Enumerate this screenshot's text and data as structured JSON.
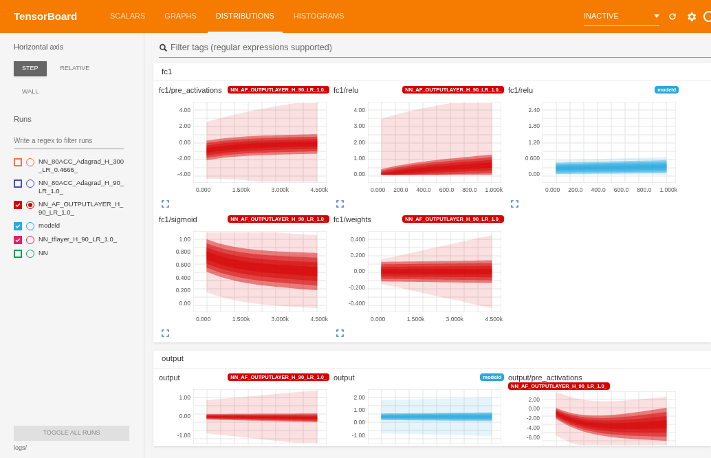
{
  "header": {
    "title": "TensorBoard",
    "tabs": [
      {
        "label": "SCALARS",
        "selected": false
      },
      {
        "label": "GRAPHS",
        "selected": false
      },
      {
        "label": "DISTRIBUTIONS",
        "selected": true
      },
      {
        "label": "HISTOGRAMS",
        "selected": false
      }
    ],
    "status_select": "INACTIVE"
  },
  "sidebar": {
    "horizontal_axis": {
      "label": "Horizontal axis",
      "options": [
        {
          "label": "STEP",
          "selected": true
        },
        {
          "label": "RELATIVE",
          "selected": false
        },
        {
          "label": "WALL",
          "selected": false
        }
      ]
    },
    "runs_label": "Runs",
    "runs_filter": {
      "placeholder": "Write a regex to filter runs"
    },
    "runs": [
      {
        "name": "NN_80ACC_Adagrad_H_300_LR_0.4666_",
        "color": "#ff7043",
        "checked": false,
        "selected": false
      },
      {
        "name": "NN_80ACC_Adagrad_H_90_LR_1.0_",
        "color": "#3f51b5",
        "checked": false,
        "selected": false
      },
      {
        "name": "NN_AF_OUTPUTLAYER_H_90_LR_1.0_",
        "color": "#d50000",
        "checked": true,
        "selected": true
      },
      {
        "name": "modeld",
        "color": "#29a8e0",
        "checked": true,
        "selected": false
      },
      {
        "name": "NN_tflayer_H_90_LR_1.0_",
        "color": "#e91e63",
        "checked": true,
        "selected": false
      },
      {
        "name": "NN",
        "color": "#0f9d58",
        "checked": false,
        "selected": false
      }
    ],
    "toggle_button": "TOGGLE ALL RUNS",
    "logdir": "logs/"
  },
  "tag_filter": {
    "placeholder": "Filter tags (regular expressions supported)"
  },
  "sections": [
    {
      "name": "fc1",
      "cards": [
        {
          "title": "fc1/pre_activations",
          "run": "NN_AF_OUTPUTLAYER_H_90_LR_1.0_",
          "color": "#d50000",
          "yticks": [
            "4.00",
            "2.00",
            "0.00",
            "-2.00",
            "-4.00"
          ],
          "xticks": [
            "0.000",
            "1.500k",
            "3.000k",
            "4.500k"
          ]
        },
        {
          "title": "fc1/relu",
          "run": "NN_AF_OUTPUTLAYER_H_90_LR_1.0_",
          "color": "#d50000",
          "yticks": [
            "4.00",
            "3.00",
            "2.00",
            "1.00",
            "0.00"
          ],
          "xticks": [
            "0.000",
            "200.0",
            "400.0",
            "600.0",
            "800.0",
            "1.000k"
          ]
        },
        {
          "title": "fc1/relu",
          "run": "modeld",
          "color": "#29a8e0",
          "yticks": [
            "2.40",
            "1.80",
            "1.20",
            "0.600",
            "0.00"
          ],
          "xticks": [
            "0.000",
            "200.0",
            "400.0",
            "600.0",
            "800.0",
            "1.000k"
          ]
        },
        {
          "title": "fc1/sigmoid",
          "run": "NN_AF_OUTPUTLAYER_H_90_LR_1.0_",
          "color": "#d50000",
          "yticks": [
            "1.00",
            "0.800",
            "0.600",
            "0.400",
            "0.200",
            "0.00"
          ],
          "xticks": [
            "0.000",
            "1.500k",
            "3.000k",
            "4.500k"
          ]
        },
        {
          "title": "fc1/weights",
          "run": "NN_AF_OUTPUTLAYER_H_90_LR_1.0_",
          "color": "#d50000",
          "yticks": [
            "0.400",
            "0.200",
            "0.00",
            "-0.200",
            "-0.400"
          ],
          "xticks": [
            "0.000",
            "1.500k",
            "3.000k",
            "4.500k"
          ]
        }
      ]
    },
    {
      "name": "output",
      "cards": [
        {
          "title": "output",
          "run": "NN_AF_OUTPUTLAYER_H_90_LR_1.0_",
          "color": "#d50000",
          "yticks": [
            "1.00",
            "0.00",
            "-1.00"
          ]
        },
        {
          "title": "output",
          "run": "modeld",
          "color": "#29a8e0",
          "yticks": [
            "2.00",
            "1.00",
            "0.00",
            "-1.00"
          ]
        },
        {
          "title": "output/pre_activations",
          "run": "NN_AF_OUTPUTLAYER_H_90_LR_1.0_",
          "color": "#d50000",
          "yticks": [
            "2.00",
            "0.00",
            "-2.00",
            "-4.00",
            "-6.00"
          ]
        }
      ]
    }
  ]
}
